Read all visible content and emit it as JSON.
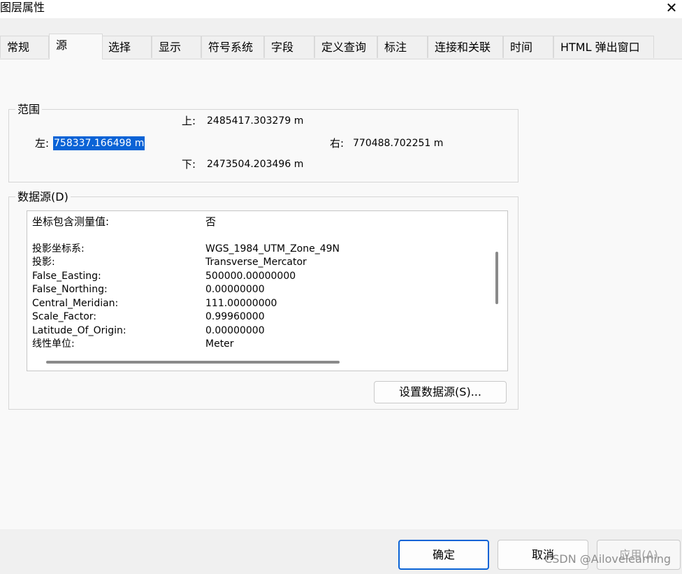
{
  "window": {
    "title": "图层属性",
    "close_glyph": "✕"
  },
  "tabs": [
    {
      "label": "常规",
      "active": false
    },
    {
      "label": "源",
      "active": true
    },
    {
      "label": "选择",
      "active": false
    },
    {
      "label": "显示",
      "active": false
    },
    {
      "label": "符号系统",
      "active": false
    },
    {
      "label": "字段",
      "active": false
    },
    {
      "label": "定义查询",
      "active": false
    },
    {
      "label": "标注",
      "active": false
    },
    {
      "label": "连接和关联",
      "active": false
    },
    {
      "label": "时间",
      "active": false
    },
    {
      "label": "HTML 弹出窗口",
      "active": false
    }
  ],
  "extent": {
    "legend": "范围",
    "top_label": "上:",
    "top_value": "2485417.303279 m",
    "left_label": "左:",
    "left_value": "758337.166498 m",
    "right_label": "右:",
    "right_value": "770488.702251 m",
    "bottom_label": "下:",
    "bottom_value": "2473504.203496 m"
  },
  "datasource": {
    "legend": "数据源(D)",
    "rows": [
      {
        "label": "坐标包含测量值:",
        "value": "否"
      },
      {
        "label": "投影坐标系:",
        "value": "WGS_1984_UTM_Zone_49N"
      },
      {
        "label": "投影:",
        "value": "Transverse_Mercator"
      },
      {
        "label": "False_Easting:",
        "value": "500000.00000000"
      },
      {
        "label": "False_Northing:",
        "value": "0.00000000"
      },
      {
        "label": "Central_Meridian:",
        "value": "111.00000000"
      },
      {
        "label": "Scale_Factor:",
        "value": "0.99960000"
      },
      {
        "label": "Latitude_Of_Origin:",
        "value": "0.00000000"
      },
      {
        "label": "线性单位:",
        "value": "Meter"
      }
    ],
    "set_source_label": "设置数据源(S)..."
  },
  "footer": {
    "ok_label": "确定",
    "cancel_label": "取消",
    "apply_label": "应用(A)"
  },
  "watermark": "CSDN @Ailovelearning",
  "colors": {
    "accent": "#0a63d6",
    "panel": "#f9f9f9",
    "background": "#f0f0f0"
  }
}
